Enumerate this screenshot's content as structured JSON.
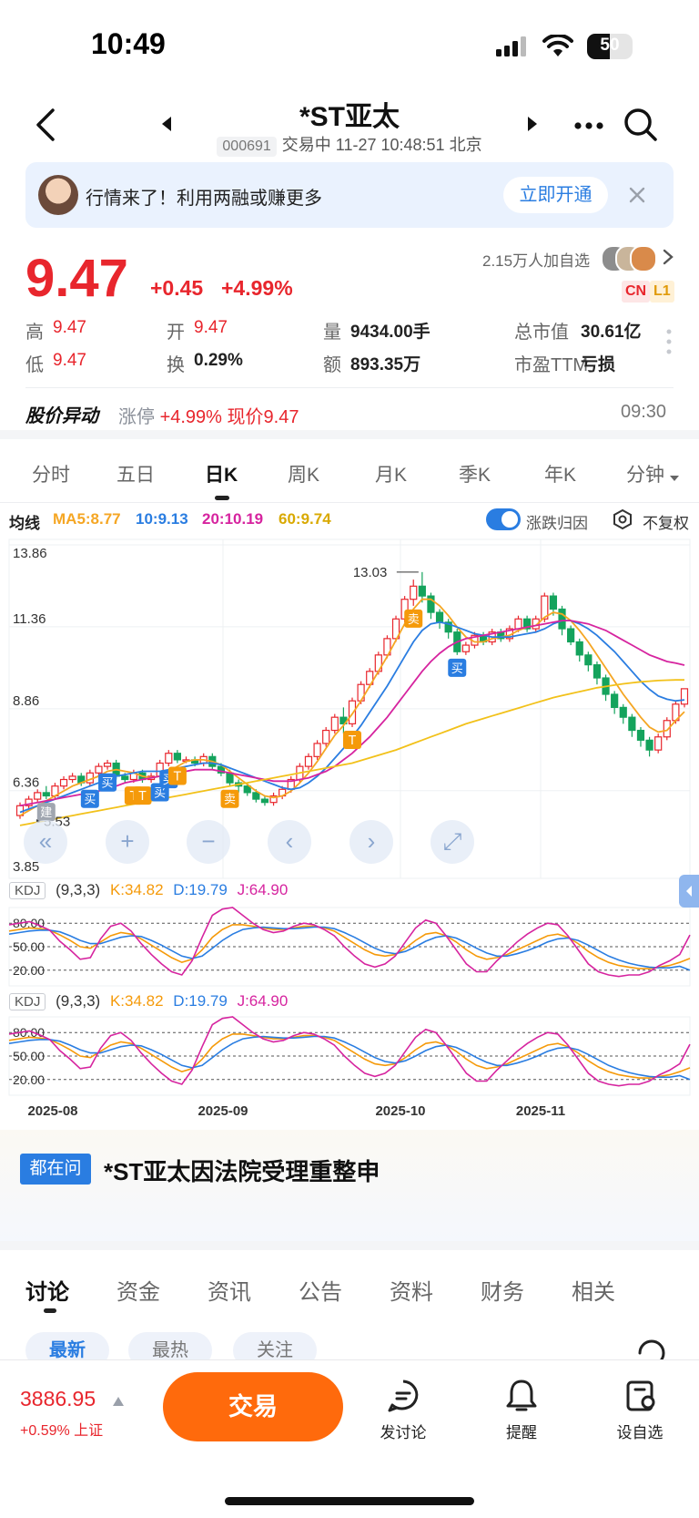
{
  "status_bar": {
    "time": "10:49",
    "battery": "50",
    "battery_level": 0.5
  },
  "header": {
    "title": "*ST亚太",
    "code": "000691",
    "status": "交易中 11-27 10:48:51 北京"
  },
  "banner": {
    "text": "行情来了！利用两融或赚更多",
    "button": "立即开通"
  },
  "quote": {
    "price": "9.47",
    "change": "+0.45",
    "change_pct": "+4.99%",
    "watchers": "2.15万人加自选",
    "tags": [
      "CN",
      "L1"
    ],
    "stats": [
      {
        "label": "高",
        "value": "9.47",
        "color": "red"
      },
      {
        "label": "开",
        "value": "9.47",
        "color": "red"
      },
      {
        "label": "量",
        "value": "9434.00手",
        "color": "dark"
      },
      {
        "label": "总市值",
        "value": "30.61亿",
        "color": "dark"
      },
      {
        "label": "低",
        "value": "9.47",
        "color": "red"
      },
      {
        "label": "换",
        "value": "0.29%",
        "color": "dark"
      },
      {
        "label": "额",
        "value": "893.35万",
        "color": "dark"
      },
      {
        "label": "市盈TTM",
        "value": "亏损",
        "color": "dark"
      }
    ]
  },
  "abnormal": {
    "title": "股价异动",
    "label": "涨停",
    "pct": "+4.99%",
    "price_text": "现价9.47",
    "time": "09:30"
  },
  "period_tabs": [
    "分时",
    "五日",
    "日K",
    "周K",
    "月K",
    "季K",
    "年K",
    "分钟"
  ],
  "active_period": 2,
  "ma_legend": {
    "title": "均线",
    "items": [
      {
        "text": "MA5:8.77",
        "color": "#f5a623"
      },
      {
        "text": "10:9.13",
        "color": "#2a7de1"
      },
      {
        "text": "20:10.19",
        "color": "#d6249f"
      },
      {
        "text": "60:9.74",
        "color": "#f2c11a"
      }
    ],
    "toggle_label": "涨跌归因",
    "restore_label": "不复权"
  },
  "chart_data": {
    "type": "candlestick",
    "ylim": [
      3.85,
      13.86
    ],
    "y_ticks": [
      "13.86",
      "11.36",
      "8.86",
      "6.36",
      "3.85"
    ],
    "x_ticks": [
      "2025-08",
      "2025-09",
      "2025-10",
      "2025-11"
    ],
    "max_label": "13.03",
    "min_label": "5.53",
    "candles": [
      [
        5.6,
        5.9,
        5.5,
        6.0
      ],
      [
        5.9,
        6.1,
        5.8,
        6.2
      ],
      [
        6.1,
        6.3,
        6.0,
        6.4
      ],
      [
        6.3,
        6.2,
        6.1,
        6.5
      ],
      [
        6.2,
        6.5,
        6.1,
        6.6
      ],
      [
        6.5,
        6.7,
        6.4,
        6.8
      ],
      [
        6.7,
        6.8,
        6.6,
        6.9
      ],
      [
        6.8,
        6.6,
        6.5,
        6.9
      ],
      [
        6.6,
        6.9,
        6.5,
        7.0
      ],
      [
        6.9,
        7.1,
        6.8,
        7.2
      ],
      [
        7.1,
        7.2,
        7.0,
        7.3
      ],
      [
        7.2,
        6.8,
        6.7,
        7.3
      ],
      [
        6.8,
        6.7,
        6.6,
        6.9
      ],
      [
        6.7,
        6.9,
        6.6,
        7.0
      ],
      [
        6.9,
        6.7,
        6.6,
        7.0
      ],
      [
        6.7,
        6.8,
        6.6,
        6.9
      ],
      [
        6.8,
        7.2,
        6.7,
        7.3
      ],
      [
        7.2,
        7.5,
        7.1,
        7.6
      ],
      [
        7.5,
        7.3,
        7.2,
        7.6
      ],
      [
        7.3,
        7.3,
        7.2,
        7.4
      ],
      [
        7.3,
        7.2,
        7.1,
        7.4
      ],
      [
        7.2,
        7.4,
        7.1,
        7.5
      ],
      [
        7.4,
        7.1,
        7.0,
        7.5
      ],
      [
        7.1,
        6.9,
        6.8,
        7.2
      ],
      [
        6.9,
        6.6,
        6.5,
        7.0
      ],
      [
        6.6,
        6.5,
        6.3,
        6.7
      ],
      [
        6.5,
        6.3,
        6.2,
        6.6
      ],
      [
        6.3,
        6.1,
        6.0,
        6.4
      ],
      [
        6.1,
        6.0,
        5.9,
        6.2
      ],
      [
        6.0,
        6.2,
        5.9,
        6.3
      ],
      [
        6.2,
        6.4,
        6.1,
        6.5
      ],
      [
        6.4,
        6.7,
        6.3,
        6.8
      ],
      [
        6.7,
        7.1,
        6.6,
        7.2
      ],
      [
        7.1,
        7.4,
        7.0,
        7.5
      ],
      [
        7.4,
        7.8,
        7.3,
        7.9
      ],
      [
        7.8,
        8.2,
        7.7,
        8.3
      ],
      [
        8.2,
        8.6,
        8.1,
        8.7
      ],
      [
        8.6,
        8.4,
        8.1,
        8.9
      ],
      [
        8.4,
        9.1,
        8.3,
        9.2
      ],
      [
        9.1,
        9.6,
        9.0,
        9.7
      ],
      [
        9.6,
        10.0,
        9.5,
        10.1
      ],
      [
        10.0,
        10.5,
        9.9,
        10.6
      ],
      [
        10.5,
        11.0,
        10.4,
        11.1
      ],
      [
        11.0,
        11.6,
        10.9,
        11.7
      ],
      [
        11.6,
        12.2,
        11.5,
        12.3
      ],
      [
        12.2,
        12.6,
        12.0,
        12.8
      ],
      [
        12.6,
        12.3,
        12.1,
        13.03
      ],
      [
        12.3,
        11.8,
        11.6,
        12.4
      ],
      [
        11.8,
        11.5,
        11.3,
        11.9
      ],
      [
        11.5,
        11.2,
        11.0,
        11.6
      ],
      [
        11.2,
        10.6,
        10.5,
        11.3
      ],
      [
        10.6,
        10.8,
        10.5,
        10.9
      ],
      [
        10.8,
        11.1,
        10.7,
        11.2
      ],
      [
        11.1,
        10.9,
        10.8,
        11.2
      ],
      [
        10.9,
        11.2,
        10.8,
        11.3
      ],
      [
        11.2,
        11.0,
        10.9,
        11.3
      ],
      [
        11.0,
        11.3,
        10.9,
        11.4
      ],
      [
        11.3,
        11.6,
        11.2,
        11.7
      ],
      [
        11.6,
        11.3,
        11.2,
        11.7
      ],
      [
        11.3,
        11.6,
        11.2,
        11.7
      ],
      [
        11.6,
        12.3,
        11.5,
        12.4
      ],
      [
        12.3,
        11.9,
        11.7,
        12.4
      ],
      [
        11.9,
        11.3,
        11.1,
        12.0
      ],
      [
        11.3,
        10.9,
        10.8,
        11.4
      ],
      [
        10.9,
        10.5,
        10.3,
        11.0
      ],
      [
        10.5,
        10.2,
        10.0,
        10.6
      ],
      [
        10.2,
        9.8,
        9.6,
        10.3
      ],
      [
        9.8,
        9.3,
        9.1,
        9.9
      ],
      [
        9.3,
        8.9,
        8.7,
        9.4
      ],
      [
        8.9,
        8.6,
        8.4,
        9.0
      ],
      [
        8.6,
        8.2,
        8.0,
        8.7
      ],
      [
        8.2,
        7.9,
        7.7,
        8.3
      ],
      [
        7.9,
        7.6,
        7.4,
        8.0
      ],
      [
        7.6,
        8.0,
        7.5,
        8.1
      ],
      [
        8.0,
        8.5,
        7.9,
        8.6
      ],
      [
        8.5,
        9.0,
        8.4,
        9.1
      ],
      [
        9.0,
        9.47,
        8.9,
        9.47
      ]
    ],
    "ma_series": [
      {
        "name": "MA5",
        "color": "#f5a623",
        "values": [
          5.6,
          5.75,
          5.9,
          6.05,
          6.2,
          6.35,
          6.5,
          6.6,
          6.7,
          6.8,
          6.95,
          7.0,
          6.95,
          6.9,
          6.8,
          6.75,
          6.8,
          6.95,
          7.1,
          7.25,
          7.3,
          7.3,
          7.25,
          7.15,
          6.95,
          6.75,
          6.55,
          6.35,
          6.2,
          6.15,
          6.2,
          6.35,
          6.6,
          6.9,
          7.25,
          7.65,
          8.05,
          8.35,
          8.7,
          9.1,
          9.55,
          10.0,
          10.45,
          10.95,
          11.45,
          11.9,
          12.2,
          12.2,
          12.0,
          11.7,
          11.35,
          11.05,
          10.9,
          10.9,
          11.0,
          11.05,
          11.1,
          11.25,
          11.35,
          11.4,
          11.65,
          11.8,
          11.75,
          11.55,
          11.25,
          10.9,
          10.5,
          10.1,
          9.7,
          9.3,
          8.95,
          8.6,
          8.3,
          8.15,
          8.2,
          8.5,
          8.77
        ]
      },
      {
        "name": "MA10",
        "color": "#2a7de1",
        "values": [
          5.7,
          5.8,
          5.9,
          6.0,
          6.1,
          6.2,
          6.3,
          6.4,
          6.5,
          6.6,
          6.7,
          6.8,
          6.85,
          6.9,
          6.95,
          6.95,
          6.95,
          7.0,
          7.05,
          7.1,
          7.15,
          7.2,
          7.2,
          7.15,
          7.05,
          6.95,
          6.85,
          6.75,
          6.65,
          6.55,
          6.45,
          6.4,
          6.45,
          6.6,
          6.8,
          7.05,
          7.35,
          7.65,
          8.0,
          8.35,
          8.75,
          9.15,
          9.55,
          10.0,
          10.45,
          10.9,
          11.25,
          11.45,
          11.5,
          11.45,
          11.35,
          11.25,
          11.15,
          11.1,
          11.05,
          11.05,
          11.05,
          11.1,
          11.15,
          11.2,
          11.3,
          11.45,
          11.55,
          11.55,
          11.45,
          11.3,
          11.1,
          10.85,
          10.6,
          10.3,
          10.0,
          9.7,
          9.45,
          9.25,
          9.15,
          9.1,
          9.13
        ]
      },
      {
        "name": "MA20",
        "color": "#d6249f",
        "values": [
          5.9,
          5.95,
          6.0,
          6.05,
          6.1,
          6.15,
          6.2,
          6.25,
          6.3,
          6.35,
          6.4,
          6.5,
          6.6,
          6.65,
          6.7,
          6.75,
          6.8,
          6.85,
          6.9,
          6.95,
          7.0,
          7.0,
          7.0,
          6.95,
          6.9,
          6.85,
          6.8,
          6.75,
          6.7,
          6.65,
          6.65,
          6.65,
          6.7,
          6.75,
          6.85,
          6.95,
          7.1,
          7.3,
          7.5,
          7.75,
          8.0,
          8.3,
          8.6,
          8.95,
          9.3,
          9.65,
          10.0,
          10.3,
          10.55,
          10.75,
          10.9,
          11.0,
          11.05,
          11.1,
          11.15,
          11.2,
          11.25,
          11.3,
          11.35,
          11.4,
          11.45,
          11.5,
          11.55,
          11.55,
          11.5,
          11.45,
          11.35,
          11.25,
          11.1,
          10.95,
          10.8,
          10.65,
          10.5,
          10.4,
          10.3,
          10.25,
          10.19
        ]
      },
      {
        "name": "MA60",
        "color": "#f2c11a",
        "values": [
          5.3,
          5.35,
          5.4,
          5.45,
          5.5,
          5.55,
          5.6,
          5.65,
          5.7,
          5.75,
          5.8,
          5.85,
          5.9,
          5.95,
          6.0,
          6.05,
          6.1,
          6.15,
          6.2,
          6.25,
          6.3,
          6.35,
          6.4,
          6.45,
          6.5,
          6.55,
          6.6,
          6.65,
          6.7,
          6.75,
          6.8,
          6.85,
          6.9,
          6.95,
          7.0,
          7.05,
          7.1,
          7.15,
          7.2,
          7.28,
          7.36,
          7.44,
          7.52,
          7.6,
          7.7,
          7.8,
          7.9,
          8.0,
          8.1,
          8.2,
          8.3,
          8.4,
          8.48,
          8.56,
          8.64,
          8.72,
          8.8,
          8.88,
          8.96,
          9.04,
          9.12,
          9.2,
          9.26,
          9.32,
          9.38,
          9.44,
          9.5,
          9.54,
          9.58,
          9.62,
          9.65,
          9.68,
          9.7,
          9.72,
          9.73,
          9.74,
          9.74
        ]
      }
    ],
    "markers": [
      {
        "i": 3,
        "text": "建",
        "color": "#a0a6b0"
      },
      {
        "i": 8,
        "text": "买",
        "color": "#2a7de1"
      },
      {
        "i": 10,
        "text": "买",
        "color": "#2a7de1"
      },
      {
        "i": 13,
        "text": "T",
        "color": "#f59a0a"
      },
      {
        "i": 14,
        "text": "T",
        "color": "#f59a0a"
      },
      {
        "i": 16,
        "text": "买",
        "color": "#2a7de1"
      },
      {
        "i": 17,
        "text": "买",
        "color": "#2a7de1"
      },
      {
        "i": 18,
        "text": "T",
        "color": "#f59a0a"
      },
      {
        "i": 24,
        "text": "卖",
        "color": "#f59a0a"
      },
      {
        "i": 38,
        "text": "T",
        "color": "#f59a0a"
      },
      {
        "i": 45,
        "text": "卖",
        "color": "#f59a0a"
      },
      {
        "i": 50,
        "text": "买",
        "color": "#2a7de1"
      }
    ],
    "kdj_panels": [
      {
        "label": "KDJ",
        "params": "(9,3,3)",
        "k": "K:34.82",
        "d": "D:19.79",
        "j": "J:64.90"
      },
      {
        "label": "KDJ",
        "params": "(9,3,3)",
        "k": "K:34.82",
        "d": "D:19.79",
        "j": "J:64.90"
      }
    ],
    "kdj_levels": [
      "80.00",
      "50.00",
      "20.00"
    ],
    "kdj_series": {
      "K": [
        70,
        72,
        74,
        73,
        71,
        65,
        58,
        50,
        48,
        56,
        64,
        68,
        66,
        60,
        52,
        44,
        36,
        30,
        34,
        46,
        62,
        72,
        78,
        78,
        76,
        74,
        72,
        72,
        74,
        76,
        76,
        74,
        70,
        62,
        54,
        46,
        40,
        38,
        40,
        48,
        58,
        66,
        68,
        64,
        56,
        46,
        38,
        34,
        36,
        40,
        46,
        52,
        58,
        64,
        66,
        62,
        54,
        44,
        36,
        30,
        26,
        24,
        22,
        22,
        24,
        26,
        30,
        35
      ],
      "D": [
        66,
        68,
        70,
        71,
        71,
        69,
        64,
        58,
        54,
        54,
        58,
        62,
        64,
        63,
        58,
        52,
        45,
        38,
        35,
        38,
        48,
        58,
        66,
        72,
        74,
        75,
        74,
        73,
        73,
        74,
        75,
        75,
        73,
        68,
        62,
        55,
        48,
        43,
        41,
        44,
        50,
        57,
        62,
        64,
        61,
        55,
        48,
        42,
        38,
        38,
        41,
        45,
        50,
        56,
        60,
        61,
        58,
        52,
        45,
        38,
        33,
        29,
        26,
        24,
        23,
        23,
        25,
        20
      ],
      "J": [
        78,
        80,
        82,
        77,
        71,
        57,
        46,
        34,
        36,
        60,
        76,
        80,
        70,
        54,
        40,
        28,
        18,
        14,
        32,
        62,
        90,
        98,
        100,
        90,
        80,
        72,
        68,
        70,
        76,
        80,
        78,
        72,
        64,
        50,
        38,
        28,
        24,
        28,
        38,
        56,
        74,
        84,
        80,
        64,
        46,
        28,
        18,
        18,
        32,
        44,
        56,
        66,
        74,
        80,
        78,
        64,
        46,
        28,
        18,
        14,
        12,
        14,
        14,
        18,
        26,
        32,
        40,
        65
      ]
    }
  },
  "news": {
    "tag": "都在问",
    "headline": "*ST亚太因法院受理重整申"
  },
  "bottom_tabs": [
    "讨论",
    "资金",
    "资讯",
    "公告",
    "资料",
    "财务",
    "相关"
  ],
  "active_bottom_tab": 0,
  "sub_pills": [
    "最新",
    "最热",
    "关注"
  ],
  "bottom_bar": {
    "index_value": "3886.95",
    "index_change": "+0.59% 上证",
    "trade_label": "交易",
    "actions": [
      "发讨论",
      "提醒",
      "设自选"
    ]
  },
  "colors": {
    "up": "#e8262d",
    "down": "#14a35c",
    "accent": "#2a7de1",
    "trade": "#ff6a0c"
  }
}
